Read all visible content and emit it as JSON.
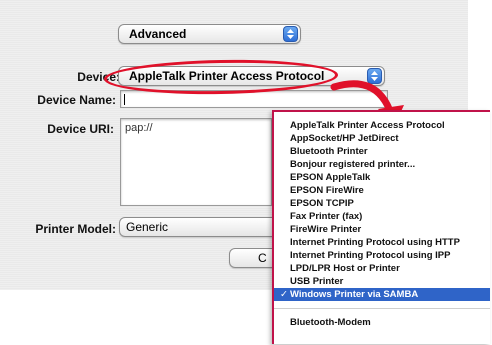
{
  "top_popup": {
    "label": "Advanced"
  },
  "device": {
    "label": "Device:",
    "value": "AppleTalk Printer Access Protocol"
  },
  "device_name": {
    "label": "Device Name:",
    "value": ""
  },
  "device_uri": {
    "label": "Device URI:",
    "value": "pap://"
  },
  "printer_model": {
    "label": "Printer Model:",
    "value": "Generic"
  },
  "partial_button": {
    "label": "C"
  },
  "menu": {
    "items": [
      {
        "label": "AppleTalk Printer Access Protocol"
      },
      {
        "label": "AppSocket/HP JetDirect"
      },
      {
        "label": "Bluetooth Printer"
      },
      {
        "label": "Bonjour registered printer..."
      },
      {
        "label": "EPSON AppleTalk"
      },
      {
        "label": "EPSON FireWire"
      },
      {
        "label": "EPSON TCPIP"
      },
      {
        "label": "Fax Printer (fax)"
      },
      {
        "label": "FireWire Printer"
      },
      {
        "label": "Internet Printing Protocol using HTTP"
      },
      {
        "label": "Internet Printing Protocol using IPP"
      },
      {
        "label": "LPD/LPR Host or Printer"
      },
      {
        "label": "USB Printer"
      },
      {
        "label": "Windows Printer via SAMBA",
        "checkmark": "✓"
      },
      {
        "label": "Bluetooth-Modem"
      }
    ]
  },
  "colors": {
    "annotation": "#e0112a",
    "selection": "#2f64c8",
    "stepper": "#2f6fd6"
  }
}
